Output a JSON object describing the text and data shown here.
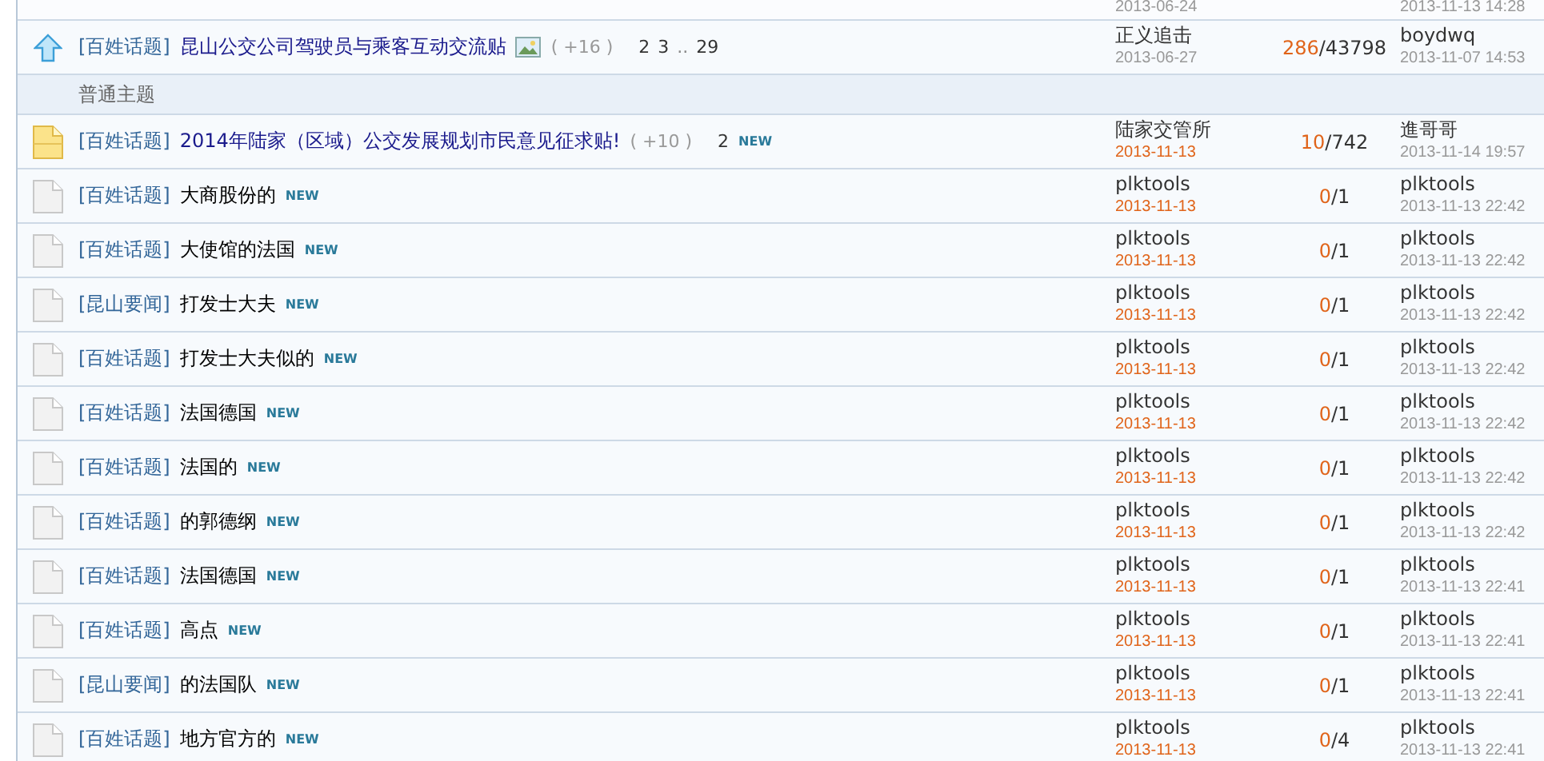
{
  "top_partial_row": {
    "author_date": "2013-06-24",
    "last_time": "2013-11-13 14:28"
  },
  "pinned_topics": [
    {
      "kind": "pinned",
      "category": "[百姓话题]",
      "title": "昆山公交公司驾驶员与乘客互动交流贴",
      "has_image": true,
      "extra": "( +16 )",
      "pages": [
        {
          "label": "2",
          "kind": "link"
        },
        {
          "label": "3",
          "kind": "link"
        },
        {
          "label": "..",
          "kind": "gap"
        },
        {
          "label": "29",
          "kind": "link"
        }
      ],
      "author": "正义追击",
      "author_date": "2013-06-27",
      "date_new": false,
      "counts": "286/43798",
      "last_user": "boydwq",
      "last_time": "2013-11-07 14:53"
    }
  ],
  "section_header": "普通主题",
  "topics": [
    {
      "kind": "hot",
      "category": "[百姓话题]",
      "title": "2014年陆家（区域）公交发展规划市民意见征求贴!",
      "extra": "( +10 )",
      "pages": [
        {
          "label": "2",
          "kind": "link"
        }
      ],
      "badge": "NEW",
      "author": "陆家交管所",
      "author_date": "2013-11-13",
      "date_new": true,
      "counts": "10/742",
      "last_user": "進哥哥",
      "last_time": "2013-11-14 19:57"
    },
    {
      "kind": "normal",
      "category": "[百姓话题]",
      "title": "大商股份的",
      "badge": "NEW",
      "author": "plktools",
      "author_date": "2013-11-13",
      "date_new": true,
      "counts": "0/1",
      "last_user": "plktools",
      "last_time": "2013-11-13 22:42"
    },
    {
      "kind": "normal",
      "category": "[百姓话题]",
      "title": "大使馆的法国",
      "badge": "NEW",
      "author": "plktools",
      "author_date": "2013-11-13",
      "date_new": true,
      "counts": "0/1",
      "last_user": "plktools",
      "last_time": "2013-11-13 22:42"
    },
    {
      "kind": "normal",
      "category": "[昆山要闻]",
      "title": "打发士大夫",
      "badge": "NEW",
      "author": "plktools",
      "author_date": "2013-11-13",
      "date_new": true,
      "counts": "0/1",
      "last_user": "plktools",
      "last_time": "2013-11-13 22:42"
    },
    {
      "kind": "normal",
      "category": "[百姓话题]",
      "title": "打发士大夫似的",
      "badge": "NEW",
      "author": "plktools",
      "author_date": "2013-11-13",
      "date_new": true,
      "counts": "0/1",
      "last_user": "plktools",
      "last_time": "2013-11-13 22:42"
    },
    {
      "kind": "normal",
      "category": "[百姓话题]",
      "title": "法国德国",
      "badge": "NEW",
      "author": "plktools",
      "author_date": "2013-11-13",
      "date_new": true,
      "counts": "0/1",
      "last_user": "plktools",
      "last_time": "2013-11-13 22:42"
    },
    {
      "kind": "normal",
      "category": "[百姓话题]",
      "title": "法国的",
      "badge": "NEW",
      "author": "plktools",
      "author_date": "2013-11-13",
      "date_new": true,
      "counts": "0/1",
      "last_user": "plktools",
      "last_time": "2013-11-13 22:42"
    },
    {
      "kind": "normal",
      "category": "[百姓话题]",
      "title": "的郭德纲",
      "badge": "NEW",
      "author": "plktools",
      "author_date": "2013-11-13",
      "date_new": true,
      "counts": "0/1",
      "last_user": "plktools",
      "last_time": "2013-11-13 22:42"
    },
    {
      "kind": "normal",
      "category": "[百姓话题]",
      "title": "法国德国",
      "badge": "NEW",
      "author": "plktools",
      "author_date": "2013-11-13",
      "date_new": true,
      "counts": "0/1",
      "last_user": "plktools",
      "last_time": "2013-11-13 22:41"
    },
    {
      "kind": "normal",
      "category": "[百姓话题]",
      "title": "高点",
      "badge": "NEW",
      "author": "plktools",
      "author_date": "2013-11-13",
      "date_new": true,
      "counts": "0/1",
      "last_user": "plktools",
      "last_time": "2013-11-13 22:41"
    },
    {
      "kind": "normal",
      "category": "[昆山要闻]",
      "title": "的法国队",
      "badge": "NEW",
      "author": "plktools",
      "author_date": "2013-11-13",
      "date_new": true,
      "counts": "0/1",
      "last_user": "plktools",
      "last_time": "2013-11-13 22:41"
    },
    {
      "kind": "normal",
      "category": "[百姓话题]",
      "title": "地方官方的",
      "badge": "NEW",
      "author": "plktools",
      "author_date": "2013-11-13",
      "date_new": true,
      "counts": "0/4",
      "last_user": "plktools",
      "last_time": "2013-11-13 22:41"
    }
  ]
}
